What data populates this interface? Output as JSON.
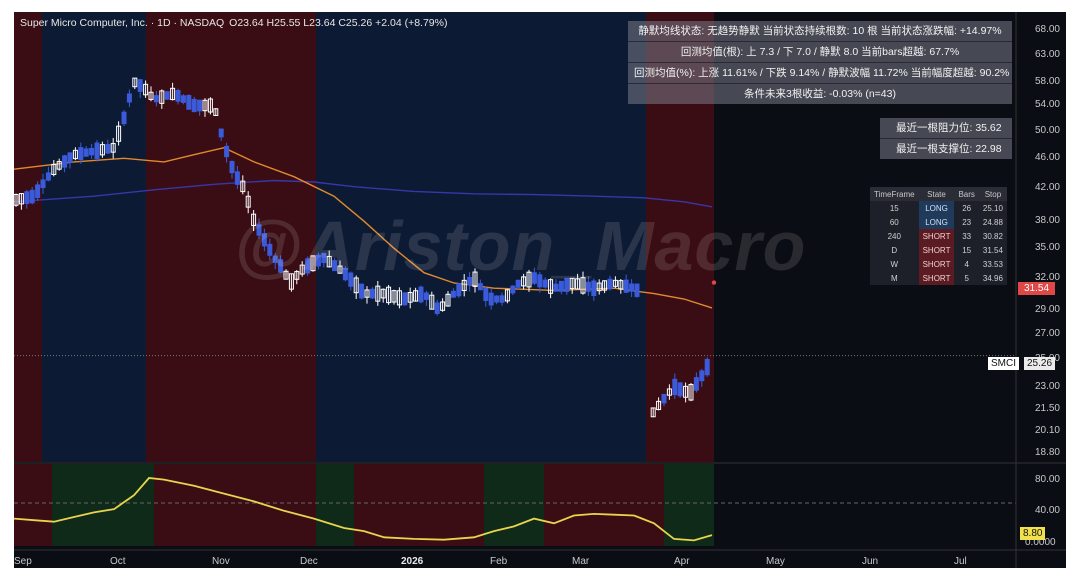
{
  "header": {
    "title": "Super Micro Computer, Inc. · 1D · NASDAQ",
    "ohlc": "O23.64  H25.55  L23.64  C25.26  +2.04 (+8.79%)"
  },
  "stats_panel": [
    "静默均线状态: 无趋势静默  当前状态持续根数: 10 根  当前状态涨跌幅: +14.97%",
    "回测均值(根): 上 7.3 / 下 7.0 / 静默 8.0  当前bars超越: 67.7%",
    "回测均值(%): 上涨 11.61% / 下跌 9.14% / 静默波幅 11.72%  当前幅度超越: 90.2%",
    "条件未来3根收益: -0.03% (n=43)"
  ],
  "support_resistance": [
    "最近一根阻力位:  35.62",
    "最近一根支撑位:  22.98"
  ],
  "timeframe_table": {
    "headers": [
      "TimeFrame",
      "State",
      "Bars",
      "Stop"
    ],
    "rows": [
      [
        "15",
        "LONG",
        "26",
        "25.10"
      ],
      [
        "60",
        "LONG",
        "23",
        "24.88"
      ],
      [
        "240",
        "SHORT",
        "33",
        "30.82"
      ],
      [
        "D",
        "SHORT",
        "15",
        "31.54"
      ],
      [
        "W",
        "SHORT",
        "4",
        "33.53"
      ],
      [
        "M",
        "SHORT",
        "5",
        "34.96"
      ]
    ]
  },
  "watermark": "@Ariston_Macro",
  "price_tags": {
    "symbol": "SMCI",
    "last_price": "25.26",
    "stop_price": "31.54",
    "oscillator_value": "8.80",
    "oscillator_zero": "0.0000"
  },
  "colors": {
    "background": "#0b0d14",
    "up_candle": "#ffffff",
    "down_candle": "#3b5bdb",
    "signal_candle": "#9c4dcc",
    "ma_orange": "#e08a2c",
    "ma_blue": "#3a35a8",
    "oscillator": "#e8d44d",
    "zone_red": "#3a0d14",
    "zone_blue": "#0d1a33",
    "zone_green": "#0f2a18"
  },
  "chart_data": {
    "type": "candlestick",
    "title": "Super Micro Computer, Inc. · 1D · NASDAQ",
    "y_axis_labels": [
      "68.00",
      "63.00",
      "58.00",
      "54.00",
      "50.00",
      "46.00",
      "42.00",
      "38.00",
      "35.00",
      "32.00",
      "29.00",
      "27.00",
      "25.00",
      "23.00",
      "21.50",
      "20.10",
      "18.80"
    ],
    "y_log": true,
    "ylim": [
      18.4,
      70
    ],
    "x_axis_labels": [
      "Sep",
      "Oct",
      "Nov",
      "Dec",
      "2026",
      "Feb",
      "Mar",
      "Apr",
      "May",
      "Jun",
      "Jul"
    ],
    "x_axis_bold": [
      "2026"
    ],
    "oscillator": {
      "y_labels": [
        "80.00",
        "40.00"
      ],
      "ylim": [
        0,
        100
      ],
      "reference_level": 50
    }
  }
}
